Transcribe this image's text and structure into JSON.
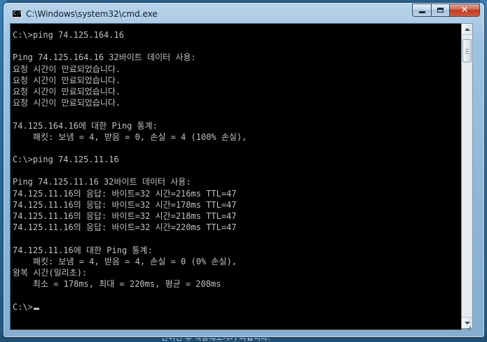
{
  "window": {
    "title": "C:\\Windows\\system32\\cmd.exe",
    "icon": "cmd-icon",
    "prompt_glyph": "C:\\"
  },
  "caption_buttons": {
    "minimize_icon": "minimize-icon",
    "maximize_icon": "maximize-icon",
    "close_icon": "close-icon",
    "close_glyph": "✕"
  },
  "console": {
    "text_color": "#c0c0c0",
    "background": "#000000",
    "lines": [
      "C:\\>ping 74.125.164.16",
      "",
      "Ping 74.125.164.16 32바이트 데이터 사용:",
      "요청 시간이 만료되었습니다.",
      "요청 시간이 만료되었습니다.",
      "요청 시간이 만료되었습니다.",
      "요청 시간이 만료되었습니다.",
      "",
      "74.125.164.16에 대한 Ping 통계:",
      "    패킷: 보냄 = 4, 받음 = 0, 손실 = 4 (100% 손실),",
      "",
      "C:\\>ping 74.125.11.16",
      "",
      "Ping 74.125.11.16 32바이트 데이터 사용:",
      "74.125.11.16의 응답: 바이트=32 시간=216ms TTL=47",
      "74.125.11.16의 응답: 바이트=32 시간=178ms TTL=47",
      "74.125.11.16의 응답: 바이트=32 시간=218ms TTL=47",
      "74.125.11.16의 응답: 바이트=32 시간=220ms TTL=47",
      "",
      "74.125.11.16에 대한 Ping 통계:",
      "    패킷: 보냄 = 4, 받음 = 4, 손실 = 0 (0% 손실),",
      "왕복 시간(밀리초):",
      "    최소 = 178ms, 최대 = 220ms, 평균 = 208ms",
      ""
    ],
    "current_prompt": "C:\\>"
  },
  "desktop": {
    "behind_text": "단이면 후 작동해보시기 바랍니다."
  }
}
